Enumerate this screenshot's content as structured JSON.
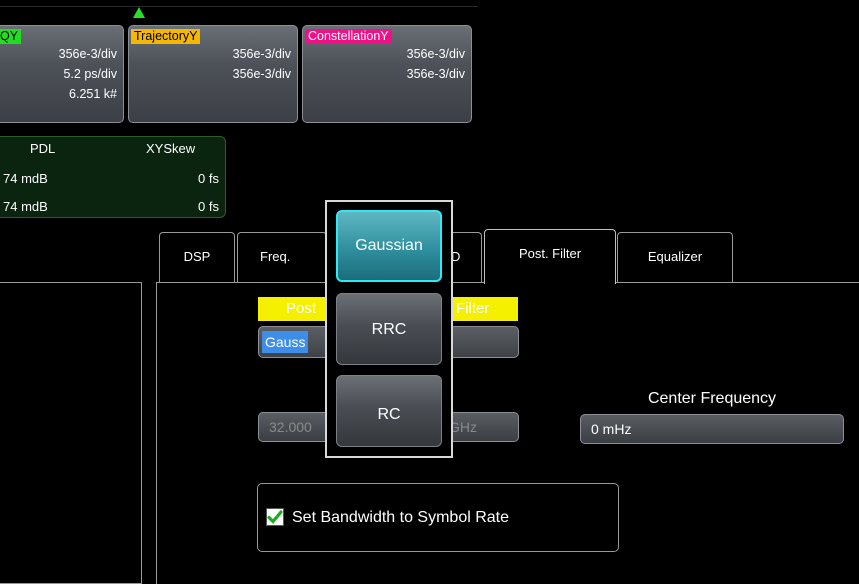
{
  "traces": [
    {
      "tag": "QY",
      "tag_color": "#22dd22",
      "values": [
        "356e-3/div",
        "5.2 ps/div",
        "6.251 k#"
      ]
    },
    {
      "tag": "TrajectoryY",
      "tag_color": "#f5b800",
      "values": [
        "356e-3/div",
        "356e-3/div"
      ]
    },
    {
      "tag": "ConstellationY",
      "tag_color": "#ee1188",
      "values": [
        "356e-3/div",
        "356e-3/div"
      ]
    }
  ],
  "measurements": {
    "headers": [
      "PDL",
      "XYSkew"
    ],
    "rows": [
      [
        "74 mdB",
        "0 fs"
      ],
      [
        "74 mdB",
        "0 fs"
      ]
    ]
  },
  "tabs": [
    {
      "label": "DSP"
    },
    {
      "label": "Freq."
    },
    {
      "label": "D"
    },
    {
      "label": "Post. Filter"
    },
    {
      "label": "Equalizer"
    }
  ],
  "post_filter": {
    "type_label_left": "Post",
    "type_label_right": "Filter",
    "type_value_visible": "Gauss",
    "bandwidth_value_left": "32.000",
    "bandwidth_value_right": "GHz",
    "center_frequency_label": "Center Frequency",
    "center_frequency_value": "0 mHz",
    "set_bw_label": "Set Bandwidth to Symbol Rate",
    "set_bw_checked": true
  },
  "dropdown": {
    "options": [
      "Gaussian",
      "RRC",
      "RC"
    ],
    "selected": "Gaussian"
  },
  "colors": {
    "selection_accent": "#33e8f0",
    "check_green": "#1faa1f",
    "highlight_blue": "#3c8ee8",
    "label_yellow": "#f5f000"
  }
}
